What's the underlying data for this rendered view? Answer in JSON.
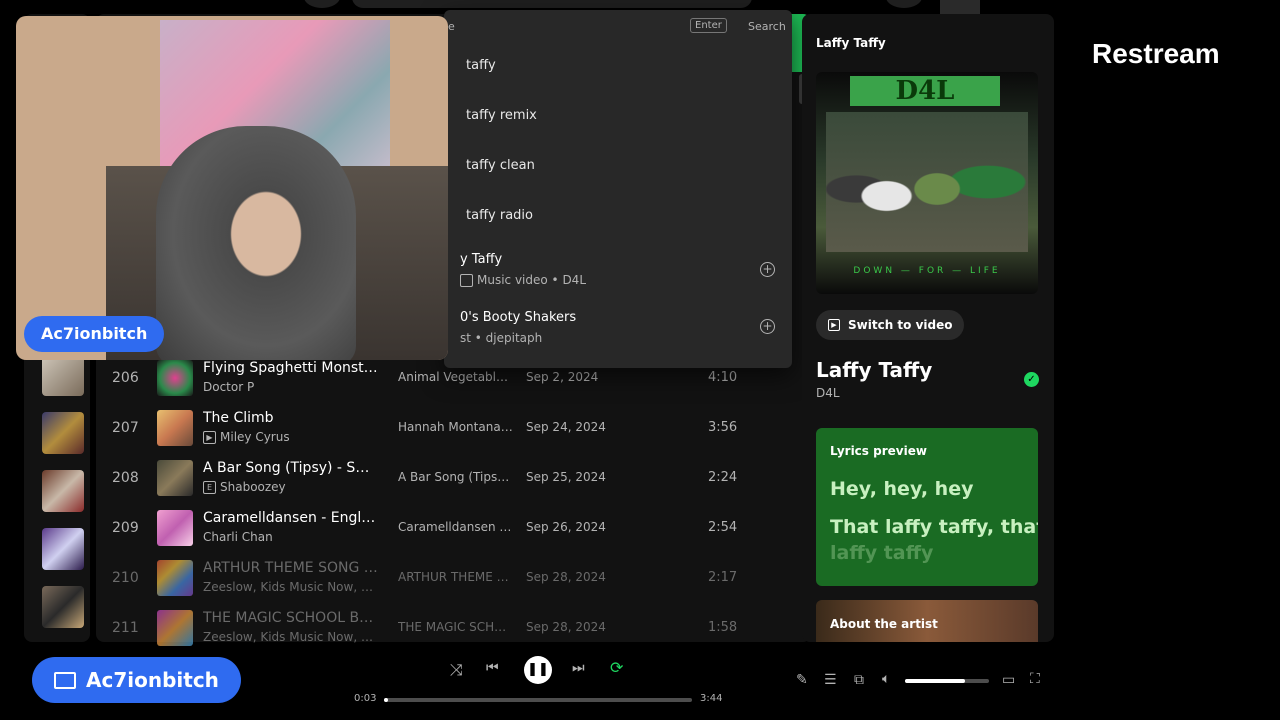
{
  "app": {
    "restream_logo": "Restream"
  },
  "webcam": {
    "name": "Ac7ionbitch"
  },
  "screen_share": {
    "name": "Ac7ionbitch"
  },
  "search": {
    "enter_hint": "Enter",
    "search_label": "Search",
    "partial_header": "e",
    "suggestions": [
      "taffy",
      "taffy remix",
      "taffy clean",
      "taffy radio"
    ],
    "results": [
      {
        "title": "y Taffy",
        "meta": "Music video • D4L"
      },
      {
        "title": "0's Booty Shakers",
        "meta": "st • djepitaph"
      }
    ]
  },
  "tracks": [
    {
      "num": "206",
      "title": "Flying Spaghetti Monster",
      "artist": "Doctor P",
      "album": "Animal Vegetable...",
      "date": "Sep 2, 2024",
      "duration": "4:10",
      "tag": ""
    },
    {
      "num": "207",
      "title": "The Climb",
      "artist": "Miley Cyrus",
      "album": "Hannah Montana ...",
      "date": "Sep 24, 2024",
      "duration": "3:56",
      "tag": "▶"
    },
    {
      "num": "208",
      "title": "A Bar Song (Tipsy) - Sped...",
      "artist": "Shaboozey",
      "album": "A Bar Song (Tipsy)...",
      "date": "Sep 25, 2024",
      "duration": "2:24",
      "tag": "E"
    },
    {
      "num": "209",
      "title": "Caramelldansen - Englis...",
      "artist": "Charli Chan",
      "album": "Caramelldansen (...",
      "date": "Sep 26, 2024",
      "duration": "2:54",
      "tag": ""
    },
    {
      "num": "210",
      "title": "ARTHUR THEME SONG - ...",
      "artist": "Zeeslow, Kids Music Now, Tr...",
      "album": "ARTHUR THEME S...",
      "date": "Sep 28, 2024",
      "duration": "2:17",
      "tag": ""
    },
    {
      "num": "211",
      "title": "THE MAGIC SCHOOL BU...",
      "artist": "Zeeslow, Kids Music Now, Tr...",
      "album": "THE MAGIC SCHO...",
      "date": "Sep 28, 2024",
      "duration": "1:58",
      "tag": ""
    }
  ],
  "now_playing": {
    "panel_title": "Laffy Taffy",
    "cover_band": "D4L",
    "cover_subtitle": "DOWN — FOR — LIFE",
    "switch_to_video": "Switch to video",
    "song": "Laffy Taffy",
    "artist": "D4L",
    "lyrics_heading": "Lyrics preview",
    "lyrics_lines": [
      "Hey, hey, hey",
      "That laffy taffy, that",
      "laffy taffy"
    ],
    "about_artist": "About the artist"
  },
  "player": {
    "elapsed": "0:03",
    "total": "3:44",
    "progress": 0.013,
    "volume": 0.72
  },
  "colors": {
    "accent": "#1ed760",
    "lyrics_bg": "#1a6b23",
    "pill": "#2f6bf0"
  }
}
